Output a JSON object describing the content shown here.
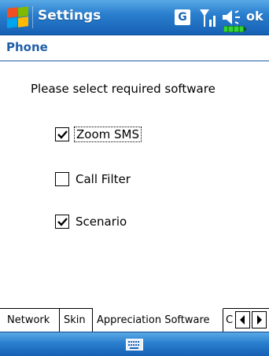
{
  "titlebar": {
    "title": "Settings",
    "network_badge": "G",
    "ok_label": "ok",
    "icons": [
      "windows-start-icon",
      "signal-icon",
      "volume-icon",
      "battery-icon"
    ]
  },
  "section": {
    "title": "Phone"
  },
  "content": {
    "prompt": "Please select required software",
    "options": [
      {
        "label": "Zoom SMS",
        "checked": true,
        "focused": true
      },
      {
        "label": "Call Filter",
        "checked": false
      },
      {
        "label": "Scenario",
        "checked": true
      }
    ]
  },
  "tabs": {
    "items": [
      {
        "label": "Network",
        "active": false
      },
      {
        "label": "Skin",
        "active": false
      },
      {
        "label": "Appreciation Software",
        "active": true
      },
      {
        "label": "C",
        "active": false
      }
    ],
    "scroll_icons": [
      "arrow-left-icon",
      "arrow-right-icon"
    ]
  },
  "bottombar": {
    "icons": [
      "keyboard-icon"
    ]
  },
  "colors": {
    "titlebar_blue": "#2a7fce",
    "section_blue": "#1f5fa8",
    "battery_green": "#35d43a"
  }
}
